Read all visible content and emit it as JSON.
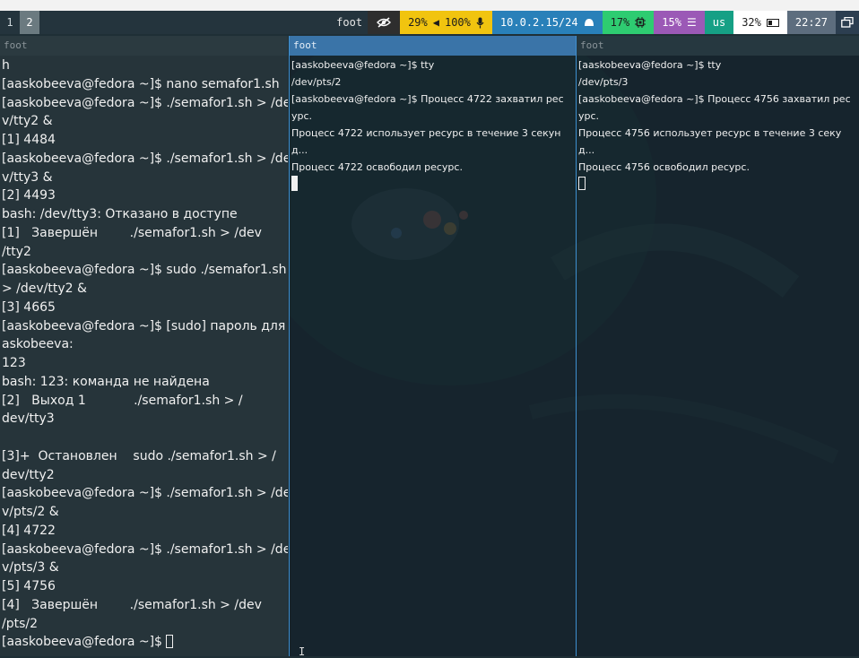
{
  "statusbar": {
    "workspaces": [
      "1",
      "2"
    ],
    "active_workspace": "2",
    "window_title": "foot",
    "audio": {
      "battery_level": "29%",
      "volume": "100%",
      "volume_icon": "speaker-icon",
      "mic_icon": "microphone-icon"
    },
    "network": {
      "ip": "10.0.2.15/24",
      "icon": "network-icon"
    },
    "cpu": {
      "value": "17%",
      "icon": "cpu-icon"
    },
    "memory": {
      "value": "15%",
      "icon": "memory-icon"
    },
    "language": "us",
    "battery": {
      "value": "32%",
      "icon": "battery-icon"
    },
    "clock": "22:27",
    "tray_icon": "tray-icon",
    "colors": {
      "audio": "#f1c40f",
      "network": "#2980b9",
      "cpu": "#2ecc71",
      "memory": "#9b59b6",
      "language": "#16a085",
      "battery": "#ffffff",
      "clock": "#5d6d7e"
    }
  },
  "terminals": [
    {
      "title": "foot",
      "focused": false,
      "lines": [
        "h",
        "[aaskobeeva@fedora ~]$ nano semafor1.sh",
        "[aaskobeeva@fedora ~]$ ./semafor1.sh > /de",
        "v/tty2 &",
        "[1] 4484",
        "[aaskobeeva@fedora ~]$ ./semafor1.sh > /de",
        "v/tty3 &",
        "[2] 4493",
        "bash: /dev/tty3: Отказано в доступе",
        "[1]   Завершён        ./semafor1.sh > /dev",
        "/tty2",
        "[aaskobeeva@fedora ~]$ sudo ./semafor1.sh",
        "> /dev/tty2 &",
        "[3] 4665",
        "[aaskobeeva@fedora ~]$ [sudo] пароль для a",
        "askobeeva:",
        "123",
        "bash: 123: команда не найдена",
        "[2]   Выход 1            ./semafor1.sh > /",
        "dev/tty3",
        "",
        "[3]+  Остановлен    sudo ./semafor1.sh > /",
        "dev/tty2",
        "[aaskobeeva@fedora ~]$ ./semafor1.sh > /de",
        "v/pts/2 &",
        "[4] 4722",
        "[aaskobeeva@fedora ~]$ ./semafor1.sh > /de",
        "v/pts/3 &",
        "[5] 4756",
        "[4]   Завершён        ./semafor1.sh > /dev",
        "/pts/2",
        "[aaskobeeva@fedora ~]$ "
      ]
    },
    {
      "title": "foot",
      "focused": true,
      "lines": [
        "[aaskobeeva@fedora ~]$ tty",
        "/dev/pts/2",
        "[aaskobeeva@fedora ~]$ Процесс 4722 захватил рес",
        "урс.",
        "Процесс 4722 использует ресурс в течение 3 секун",
        "д...",
        "Процесс 4722 освободил ресурс."
      ]
    },
    {
      "title": "foot",
      "focused": false,
      "lines": [
        "[aaskobeeva@fedora ~]$ tty",
        "/dev/pts/3",
        "[aaskobeeva@fedora ~]$ Процесс 4756 захватил рес",
        "урс.",
        "Процесс 4756 использует ресурс в течение 3 секу",
        "д...",
        "Процесс 4756 освободил ресурс."
      ]
    }
  ]
}
